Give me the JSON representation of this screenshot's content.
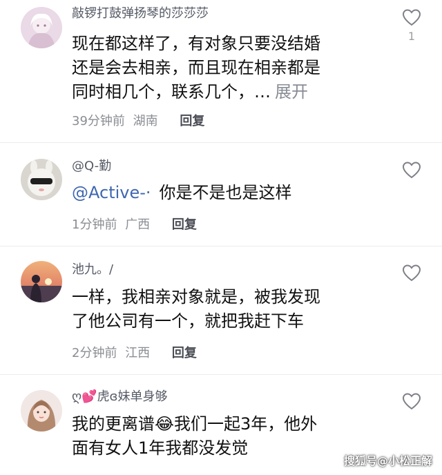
{
  "comments": [
    {
      "username": "敲锣打鼓弹扬琴的莎莎莎",
      "text": [
        "现在都这样了，有对象只要没结婚",
        "还是会去相亲，而且现在相亲都是",
        "同时相几个，联系几个，…"
      ],
      "expand_label": "展开",
      "time": "39分钟前",
      "location": "湖南",
      "reply_label": "回复",
      "like_count": "1"
    },
    {
      "username": "@Q-勤",
      "mention": "@Active-·",
      "text": [
        "你是不是也是这样"
      ],
      "time": "1分钟前",
      "location": "广西",
      "reply_label": "回复"
    },
    {
      "username": "池九。/",
      "text": [
        "一样，我相亲对象就是，被我发现",
        "了他公司有一个，就把我赶下车"
      ],
      "time": "2分钟前",
      "location": "江西",
      "reply_label": "回复"
    },
    {
      "username": "ღ💕虎ɞ妹单身够",
      "text": [
        "我的更离谱😂我们一起3年，他外",
        "面有女人1年我都没发觉"
      ]
    }
  ],
  "watermark": "搜狐号@小松正解",
  "icons": {
    "like": "heart-outline-icon"
  },
  "colors": {
    "text": "#111111",
    "username": "#555a66",
    "meta": "#8a8d93",
    "mention": "#3f67b0"
  }
}
